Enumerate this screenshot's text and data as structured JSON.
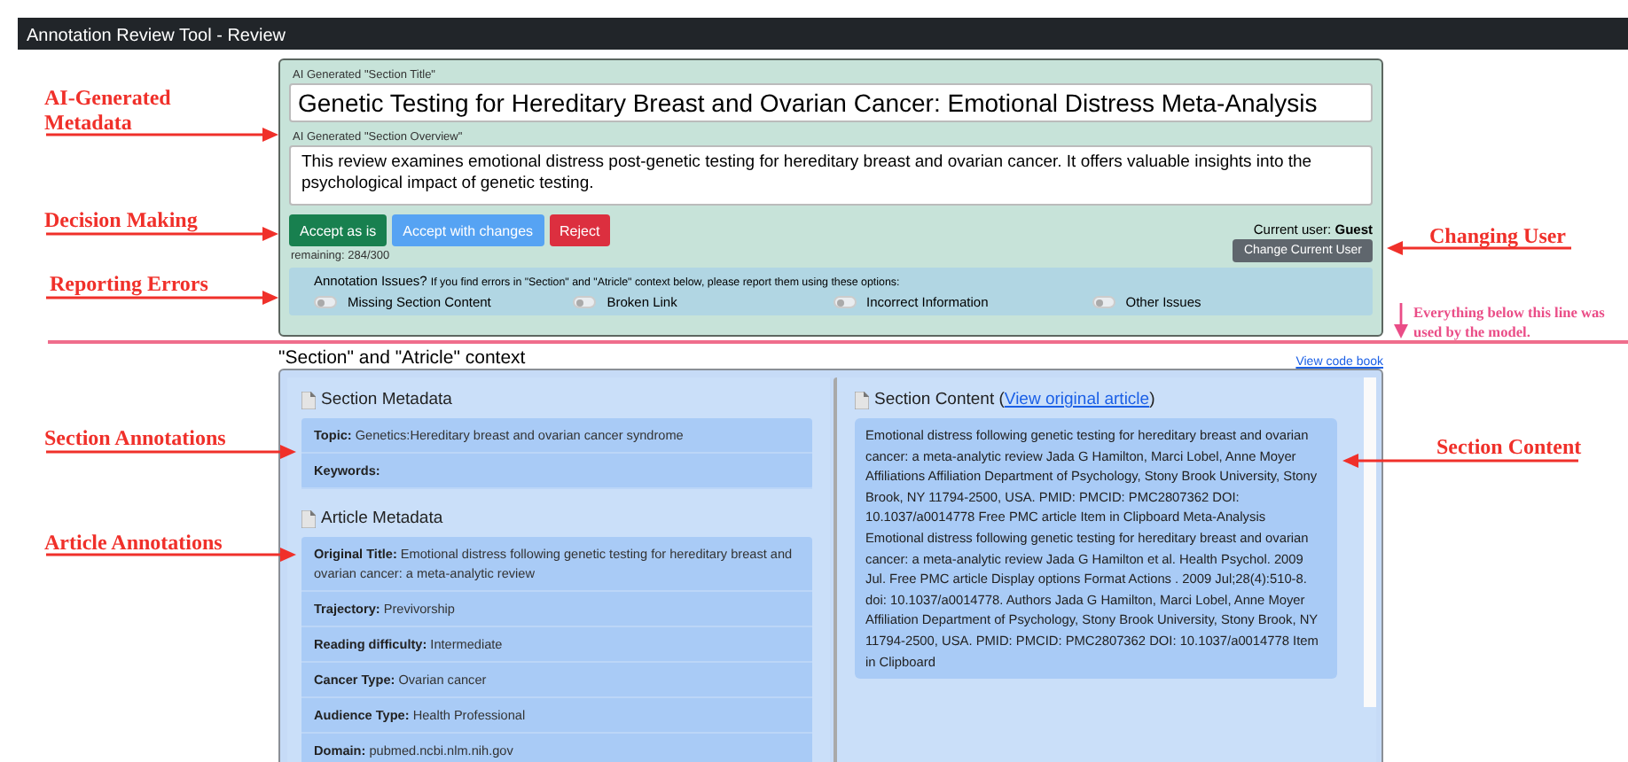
{
  "window": {
    "title": "Annotation Review Tool - Review"
  },
  "review": {
    "title_label": "AI Generated \"Section Title\"",
    "title_value": "Genetic Testing for Hereditary Breast and Ovarian Cancer: Emotional Distress Meta-Analysis",
    "overview_label": "AI Generated \"Section Overview\"",
    "overview_value": "This review examines emotional distress post-genetic testing for hereditary breast and ovarian cancer. It offers valuable insights into the psychological impact of genetic testing.",
    "buttons": [
      {
        "label": "Accept as is",
        "kind": "success"
      },
      {
        "label": "Accept with changes",
        "kind": "primary"
      },
      {
        "label": "Reject",
        "kind": "danger"
      }
    ],
    "remaining": "remaining: 284/300",
    "current_user": "Current user: **Guest**",
    "change_user_button": "Change Current User"
  },
  "issues": {
    "heading": "Annotation Issues?",
    "hint": "If you find errors in \"Section\" and \"Atricle\" context below, please report them using these options:",
    "toggles": [
      {
        "label": "Missing Section Content",
        "on": false
      },
      {
        "label": "Broken Link",
        "on": false
      },
      {
        "label": "Incorrect Information",
        "on": false
      },
      {
        "label": "Other Issues",
        "on": false
      }
    ]
  },
  "context": {
    "heading": "\"Section\" and \"Atricle\" context",
    "code_book_link": "View code book",
    "section_metadata": {
      "title": "Section Metadata",
      "fields": [
        {
          "label": "Topic:",
          "value": "Genetics:Hereditary breast and ovarian cancer syndrome"
        },
        {
          "label": "Keywords:"
        }
      ]
    },
    "article_metadata": {
      "title": "Article Metadata",
      "fields": [
        {
          "label": "Original Title:",
          "value": "Emotional distress following genetic testing for hereditary breast and ovarian cancer: a meta-analytic review"
        },
        {
          "label": "Trajectory:",
          "value": "Previvorship"
        },
        {
          "label": "Reading difficulty:",
          "value": "Intermediate"
        },
        {
          "label": "Cancer Type:",
          "value": "Ovarian cancer"
        },
        {
          "label": "Audience Type:",
          "value": "Health Professional"
        },
        {
          "label": "Domain:",
          "value": "pubmed.ncbi.nlm.nih.gov"
        }
      ]
    },
    "section_content": {
      "title": "Section Content (",
      "link": "View original article",
      "title_end": ")",
      "text": "Emotional distress following genetic testing for hereditary breast and ovarian cancer: a meta-analytic review Jada G Hamilton, Marci Lobel, Anne Moyer Affiliations Affiliation Department of Psychology, Stony Brook University, Stony Brook, NY 11794-2500, USA. PMID: PMCID: PMC2807362 DOI: 10.1037/a0014778 Free PMC article Item in Clipboard Meta-Analysis Emotional distress following genetic testing for hereditary breast and ovarian cancer: a meta-analytic review Jada G Hamilton et al. Health Psychol. 2009 Jul. Free PMC article Display options Format Actions . 2009 Jul;28(4):510-8. doi: 10.1037/a0014778. Authors Jada G Hamilton, Marci Lobel, Anne Moyer Affiliation Department of Psychology, Stony Brook University, Stony Brook, NY 11794-2500, USA. PMID: PMCID: PMC2807362 DOI: 10.1037/a0014778 Item in Clipboard"
    }
  },
  "annotations": [
    {
      "text": "AI-Generated Metadata",
      "kind": "left"
    },
    {
      "text": "Decision Making",
      "kind": "left"
    },
    {
      "text": "Reporting Errors",
      "kind": "left"
    },
    {
      "text": "Section Annotations",
      "kind": "left"
    },
    {
      "text": "Article Annotations",
      "kind": "left"
    },
    {
      "text": "Changing User",
      "kind": "right"
    },
    {
      "text": "Section Content",
      "kind": "right"
    }
  ],
  "divider_note": "Everything below this line was used by the model."
}
